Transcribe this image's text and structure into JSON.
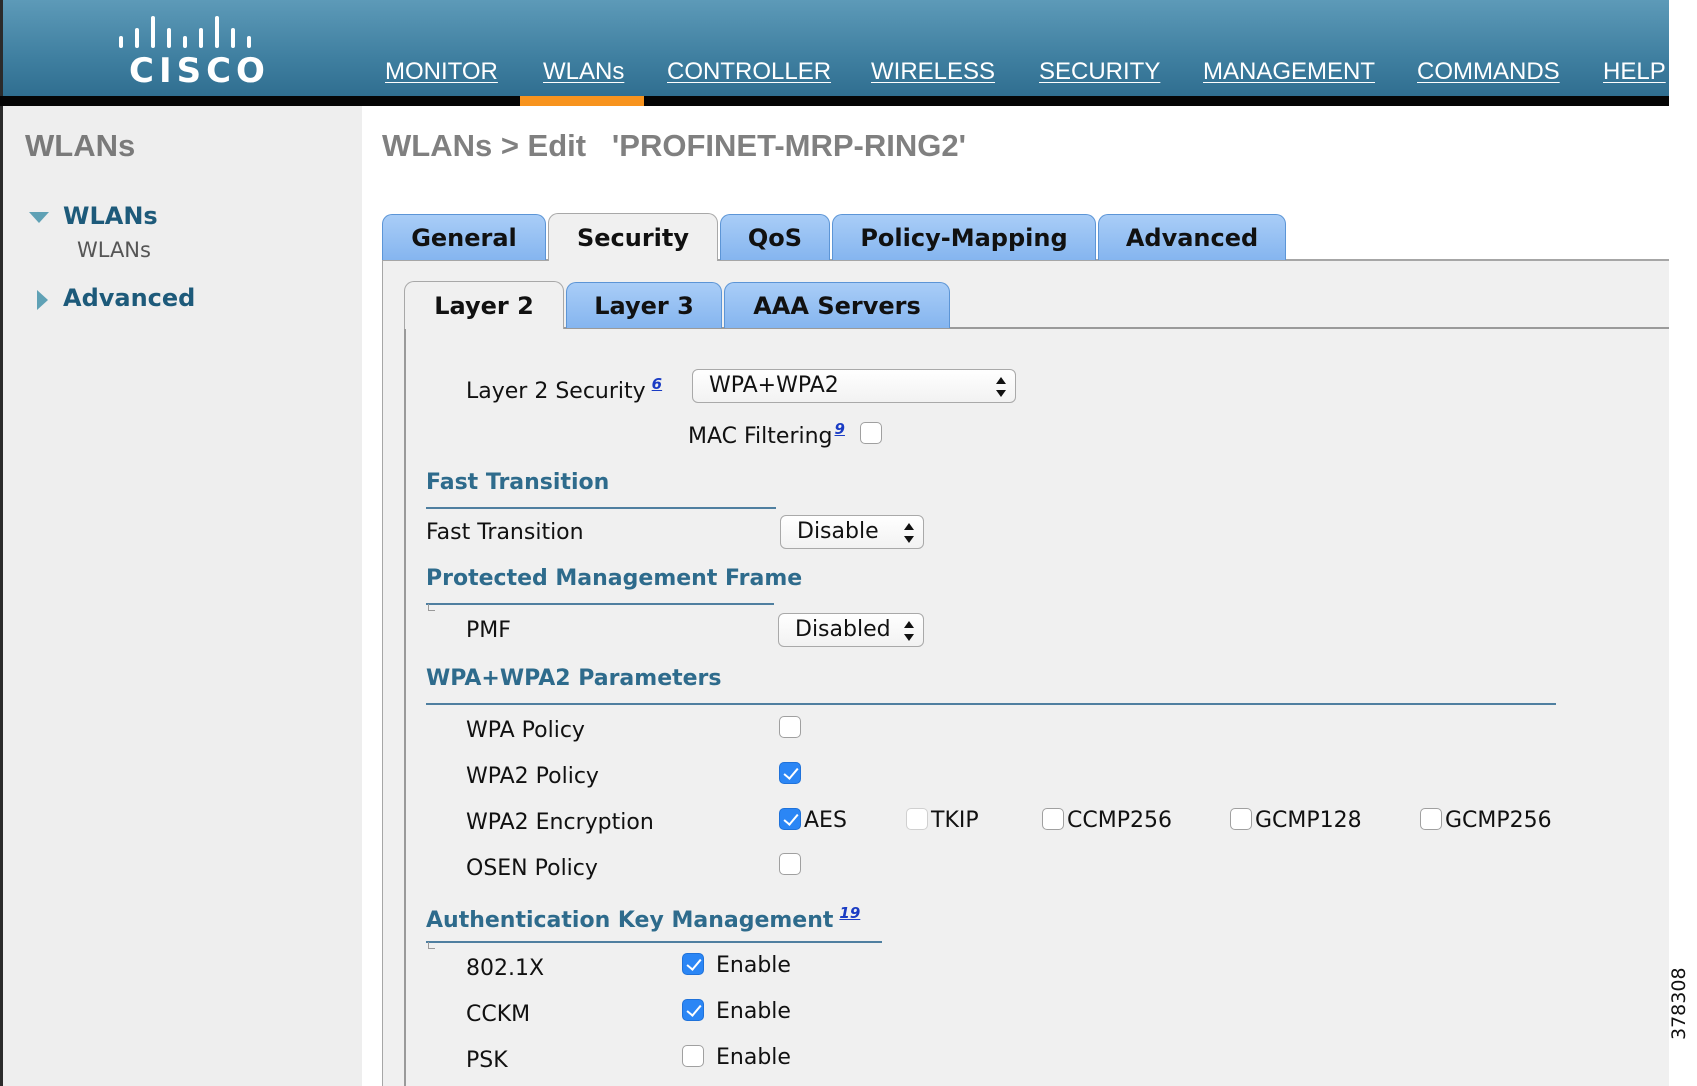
{
  "brand": {
    "logo_text": "CISCO",
    "header_color": "#3f7fa0",
    "active_color": "#f7931e"
  },
  "nav": {
    "items": [
      {
        "label": "MONITOR"
      },
      {
        "label": "WLANs"
      },
      {
        "label": "CONTROLLER"
      },
      {
        "label": "WIRELESS"
      },
      {
        "label": "SECURITY"
      },
      {
        "label": "MANAGEMENT"
      },
      {
        "label": "COMMANDS"
      },
      {
        "label": "HELP"
      }
    ],
    "active": "WLANs"
  },
  "sidebar": {
    "title": "WLANs",
    "items": [
      {
        "label": "WLANs",
        "icon": "triangle-down-icon",
        "expanded": true,
        "children": [
          {
            "label": "WLANs"
          }
        ]
      },
      {
        "label": "Advanced",
        "icon": "triangle-right-icon",
        "expanded": false
      }
    ]
  },
  "page": {
    "title": "WLANs > Edit   'PROFINET-MRP-RING2'"
  },
  "tabs": [
    {
      "label": "General"
    },
    {
      "label": "Security",
      "active": true
    },
    {
      "label": "QoS"
    },
    {
      "label": "Policy-Mapping"
    },
    {
      "label": "Advanced"
    }
  ],
  "subtabs": [
    {
      "label": "Layer 2",
      "active": true
    },
    {
      "label": "Layer 3"
    },
    {
      "label": "AAA Servers"
    }
  ],
  "layer2": {
    "security_label": "Layer 2 Security",
    "security_footnote": "6",
    "security_value": "WPA+WPA2",
    "mac_filtering_label": "MAC Filtering",
    "mac_filtering_footnote": "9",
    "mac_filtering_checked": false
  },
  "fast_transition": {
    "heading": "Fast Transition",
    "label": "Fast Transition",
    "value": "Disable"
  },
  "pmf": {
    "heading": "Protected Management Frame",
    "label": "PMF",
    "value": "Disabled"
  },
  "wpa": {
    "heading": "WPA+WPA2 Parameters",
    "wpa_policy_label": "WPA Policy",
    "wpa_policy_checked": false,
    "wpa2_policy_label": "WPA2 Policy",
    "wpa2_policy_checked": true,
    "encryption_label": "WPA2 Encryption",
    "encryption_options": [
      {
        "label": "AES",
        "checked": true
      },
      {
        "label": "TKIP",
        "checked": false
      },
      {
        "label": "CCMP256",
        "checked": false
      },
      {
        "label": "GCMP128",
        "checked": false
      },
      {
        "label": "GCMP256",
        "checked": false
      }
    ],
    "osen_policy_label": "OSEN Policy",
    "osen_policy_checked": false
  },
  "akm": {
    "heading": "Authentication Key Management",
    "footnote": "19",
    "enable_label": "Enable",
    "rows": [
      {
        "label": "802.1X",
        "checked": true
      },
      {
        "label": "CCKM",
        "checked": true
      },
      {
        "label": "PSK",
        "checked": false
      }
    ]
  },
  "figure_id": "378308"
}
